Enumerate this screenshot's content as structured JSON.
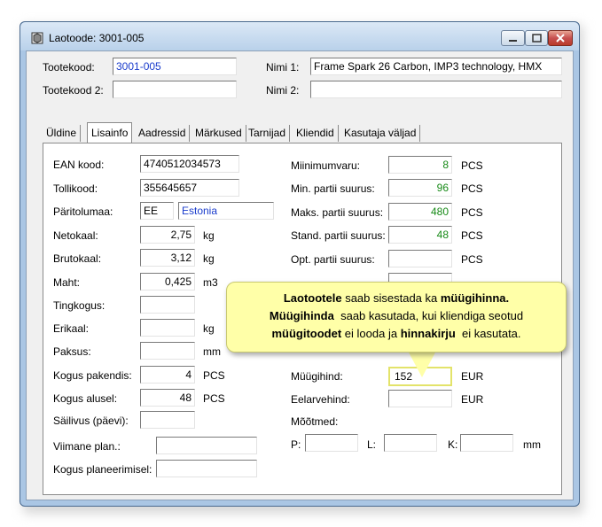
{
  "window": {
    "title": "Laotoode: 3001-005"
  },
  "header": {
    "tootekood_label": "Tootekood:",
    "tootekood_value": "3001-005",
    "tootekood2_label": "Tootekood 2:",
    "tootekood2_value": "",
    "nimi1_label": "Nimi 1:",
    "nimi1_value": "Frame Spark 26 Carbon, IMP3 technology, HMX",
    "nimi2_label": "Nimi 2:",
    "nimi2_value": ""
  },
  "tabs": [
    "Üldine",
    "Lisainfo",
    "Aadressid",
    "Märkused",
    "Tarnijad",
    "Kliendid",
    "Kasutaja väljad"
  ],
  "left": {
    "ean_label": "EAN kood:",
    "ean_value": "4740512034573",
    "toll_label": "Tollikood:",
    "toll_value": "355645657",
    "paritolu_label": "Päritolumaa:",
    "paritolu_code": "EE",
    "paritolu_name": "Estonia",
    "neto_label": "Netokaal:",
    "neto_value": "2,75",
    "neto_unit": "kg",
    "bruto_label": "Brutokaal:",
    "bruto_value": "3,12",
    "bruto_unit": "kg",
    "maht_label": "Maht:",
    "maht_value": "0,425",
    "maht_unit": "m3",
    "tingkogus_label": "Tingkogus:",
    "erikaal_label": "Erikaal:",
    "erikaal_unit": "kg",
    "paksus_label": "Paksus:",
    "paksus_unit": "mm",
    "pakend_label": "Kogus pakendis:",
    "pakend_value": "4",
    "pakend_unit": "PCS",
    "alus_label": "Kogus alusel:",
    "alus_value": "48",
    "alus_unit": "PCS",
    "sailivus_label": "Säilivus (päevi):",
    "plan_label": "Viimane plan.:",
    "planeer_label": "Kogus planeerimisel:"
  },
  "right": {
    "miinimum_label": "Miinimumvaru:",
    "miinimum_value": "8",
    "miinimum_unit": "PCS",
    "minpartii_label": "Min. partii suurus:",
    "minpartii_value": "96",
    "minpartii_unit": "PCS",
    "makspartii_label": "Maks. partii suurus:",
    "makspartii_value": "480",
    "makspartii_unit": "PCS",
    "standpartii_label": "Stand. partii suurus:",
    "standpartii_value": "48",
    "standpartii_unit": "PCS",
    "optpartii_label": "Opt. partii suurus:",
    "optpartii_unit": "PCS",
    "muugihind_label": "Müügihind:",
    "muugihind_value": "152",
    "muugihind_unit": "EUR",
    "eelarve_label": "Eelarvehind:",
    "eelarve_unit": "EUR",
    "mootmed_label": "Mõõtmed:",
    "p_label": "P:",
    "l_label": "L:",
    "k_label": "K:",
    "mm_unit": "mm"
  },
  "callout": {
    "l1a": "Laotootele",
    "l1b": " saab sisestada ka ",
    "l1c": "müügihinna.",
    "l2a": "Müügihinda",
    "l2b": "  saab kasutada, kui kliendiga seotud",
    "l3a": "müügitoodet",
    "l3b": " ei looda ja ",
    "l3c": "hinnakirju",
    "l3d": "  ei kasutata."
  }
}
